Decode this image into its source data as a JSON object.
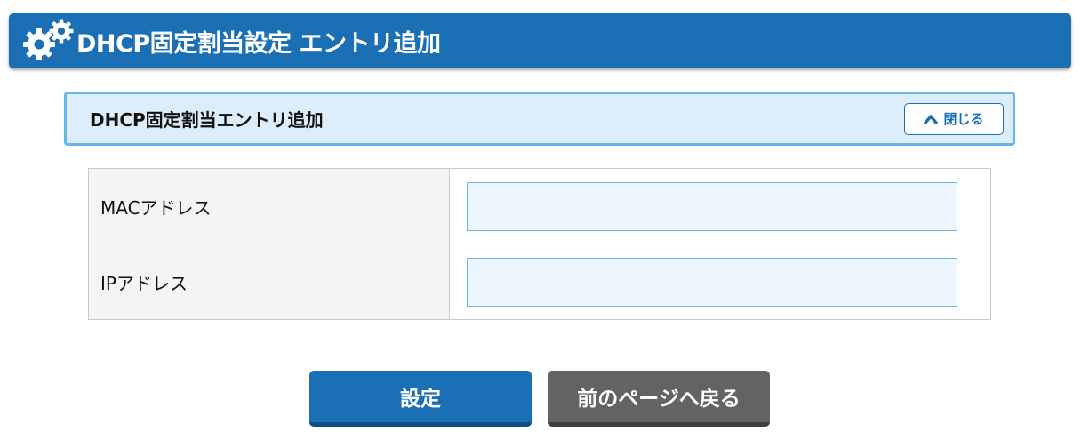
{
  "header": {
    "title": "DHCP固定割当設定 エントリ追加",
    "icon": "gears-icon"
  },
  "section": {
    "title": "DHCP固定割当エントリ追加",
    "close_label": "閉じる",
    "close_icon": "chevron-up-icon"
  },
  "form": {
    "rows": [
      {
        "label": "MACアドレス",
        "value": "",
        "placeholder": ""
      },
      {
        "label": "IPアドレス",
        "value": "",
        "placeholder": ""
      }
    ]
  },
  "actions": {
    "submit_label": "設定",
    "back_label": "前のページへ戻る"
  },
  "colors": {
    "primary": "#1a6fb5",
    "section_bg": "#dcedfb",
    "section_border": "#6ab4e8",
    "secondary_button": "#636363"
  }
}
